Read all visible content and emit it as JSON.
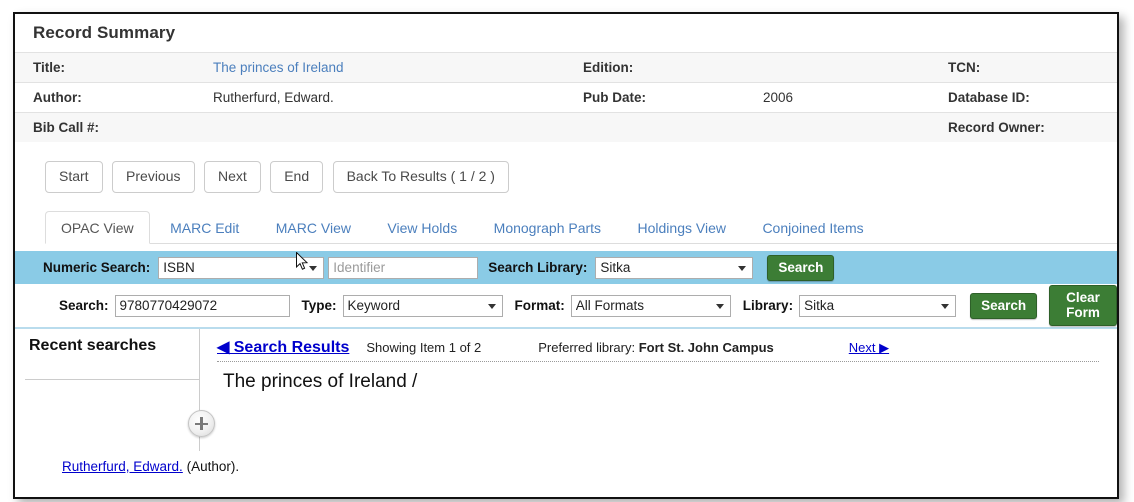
{
  "record_summary": {
    "heading": "Record Summary",
    "rows": [
      {
        "label1": "Title:",
        "value1": "The princes of Ireland",
        "value1_is_link": true,
        "label2": "Edition:",
        "value2": "",
        "label3": "TCN:",
        "value3": ""
      },
      {
        "label1": "Author:",
        "value1": "Rutherfurd, Edward.",
        "value1_is_link": false,
        "label2": "Pub Date:",
        "value2": "2006",
        "label3": "Database ID:",
        "value3": ""
      },
      {
        "label1": "Bib Call #:",
        "value1": "",
        "value1_is_link": false,
        "label2": "",
        "value2": "",
        "label3": "Record Owner:",
        "value3": ""
      }
    ]
  },
  "nav_buttons": [
    {
      "label": "Start"
    },
    {
      "label": "Previous"
    },
    {
      "label": "Next"
    },
    {
      "label": "End"
    },
    {
      "label": "Back To Results ( 1 / 2 )"
    }
  ],
  "tabs": [
    {
      "label": "OPAC View",
      "active": true
    },
    {
      "label": "MARC Edit",
      "active": false
    },
    {
      "label": "MARC View",
      "active": false
    },
    {
      "label": "View Holds",
      "active": false
    },
    {
      "label": "Monograph Parts",
      "active": false
    },
    {
      "label": "Holdings View",
      "active": false
    },
    {
      "label": "Conjoined Items",
      "active": false
    }
  ],
  "numeric_search": {
    "label": "Numeric Search:",
    "type_value": "ISBN",
    "identifier_value": "",
    "identifier_placeholder": "Identifier",
    "library_label": "Search Library:",
    "library_value": "Sitka",
    "search_button": "Search",
    "band_color": "#8acbe6"
  },
  "basic_search": {
    "search_label": "Search:",
    "search_value": "9780770429072",
    "type_label": "Type:",
    "type_value": "Keyword",
    "format_label": "Format:",
    "format_value": "All Formats",
    "library_label": "Library:",
    "library_value": "Sitka",
    "search_button": "Search",
    "clear_button": "Clear Form",
    "button_color": "#3c7d35"
  },
  "recent_searches": {
    "heading": "Recent searches",
    "expand_icon": "plus-icon"
  },
  "results": {
    "back_link": "◀ Search Results",
    "showing": "Showing Item 1 of 2",
    "preferred_library_label": "Preferred library:",
    "preferred_library_value": "Fort St. John Campus",
    "next_link": "Next ▶",
    "record_title": "The princes of Ireland /",
    "record_author": "Rutherfurd, Edward.",
    "record_author_role": "(Author)."
  }
}
